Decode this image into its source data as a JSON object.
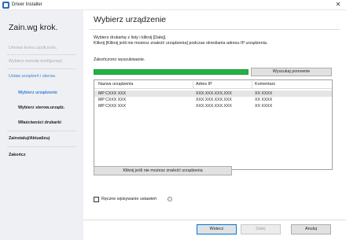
{
  "window": {
    "title": "Driver Installer",
    "close_glyph": "✕",
    "app_icon": "printer-app-icon"
  },
  "sidebar": {
    "title": "Zain.wg krok.",
    "steps": [
      {
        "label": "Umowa licenc.użytk.końc.",
        "state": "done"
      },
      {
        "label": "Wybierz metodę konfiguracji",
        "state": "done"
      },
      {
        "label": "Ustaw urządzeń i sterow.",
        "state": "current"
      },
      {
        "label": "Wybierz urządzenie",
        "state": "current-sub"
      },
      {
        "label": "Wybierz sterow.urządz.",
        "state": "sub"
      },
      {
        "label": "Właściwości drukarki",
        "state": "sub"
      },
      {
        "label": "Zainstaluj/Aktualizuj",
        "state": "main"
      },
      {
        "label": "Zakończ",
        "state": "main"
      }
    ]
  },
  "main": {
    "title": "Wybierz urządzenie",
    "instruction_line1": "Wybierz drukarkę z listy i kliknij [Dalej].",
    "instruction_line2": "Kliknij [Kliknij jeśli nie możesz znaleźć urządzenia] podczas określania adresu IP urządzenia.",
    "search_status": "Zakończono wyszukiwanie.",
    "progress": 1.0,
    "progress_color": "#24b146",
    "search_again_label": "Wyszukaj ponownie",
    "table": {
      "headers": [
        "Nazwa urządzenia",
        "Adres IP",
        "Komentarz"
      ],
      "rows": [
        {
          "name": "MP CXXX XXX",
          "ip": "XXX.XXX.XXX.XXX",
          "comment": "XX XXXX",
          "selected": true
        },
        {
          "name": "MP CXXX XXX",
          "ip": "XXX.XXX.XXX.XXX",
          "comment": "XX XXXX",
          "selected": false
        },
        {
          "name": "MP CXXX XXX",
          "ip": "XXX.XXX.XXX.XXX",
          "comment": "XX XXXX",
          "selected": false
        }
      ]
    },
    "cant_find_label": "Kliknij jeśli nie możesz znaleźć urządzenia",
    "manual_settings_label": "Ręczne wpisywanie ustawień",
    "manual_settings_checked": false,
    "info_glyph": "i"
  },
  "footer": {
    "back_label": "Wstecz",
    "next_label": "Dalej",
    "cancel_label": "Anuluj"
  },
  "colors": {
    "accent": "#3a7fd5",
    "sidebar_bg": "#eef0f3",
    "selected_row": "#e5e5e5"
  }
}
